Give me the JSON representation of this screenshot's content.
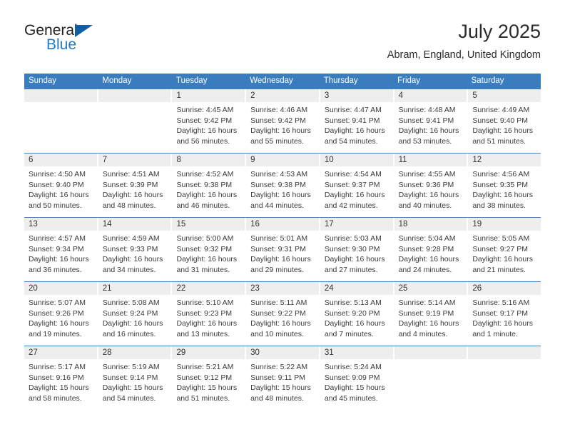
{
  "brand": {
    "name_part1": "General",
    "name_part2": "Blue",
    "accent_color": "#2079c4",
    "triangle_color": "#115da6",
    "triangle_icon": "triangle-icon"
  },
  "header": {
    "title": "July 2025",
    "subtitle": "Abram, England, United Kingdom"
  },
  "theme": {
    "header_bg": "#3a7dbe",
    "header_text": "#ffffff",
    "row_divider": "#4a7ebb",
    "daynum_band_bg": "#eeeeee",
    "cell_bg": "#ffffff",
    "body_text": "#3b3b3b"
  },
  "weekday_headers": [
    "Sunday",
    "Monday",
    "Tuesday",
    "Wednesday",
    "Thursday",
    "Friday",
    "Saturday"
  ],
  "labels": {
    "sunrise_prefix": "Sunrise:",
    "sunset_prefix": "Sunset:",
    "daylight_prefix": "Daylight:"
  },
  "weeks": [
    [
      {
        "day": "",
        "line1": "",
        "line2": "",
        "line3": "",
        "line4": ""
      },
      {
        "day": "",
        "line1": "",
        "line2": "",
        "line3": "",
        "line4": ""
      },
      {
        "day": "1",
        "line1": "Sunrise: 4:45 AM",
        "line2": "Sunset: 9:42 PM",
        "line3": "Daylight: 16 hours",
        "line4": "and 56 minutes."
      },
      {
        "day": "2",
        "line1": "Sunrise: 4:46 AM",
        "line2": "Sunset: 9:42 PM",
        "line3": "Daylight: 16 hours",
        "line4": "and 55 minutes."
      },
      {
        "day": "3",
        "line1": "Sunrise: 4:47 AM",
        "line2": "Sunset: 9:41 PM",
        "line3": "Daylight: 16 hours",
        "line4": "and 54 minutes."
      },
      {
        "day": "4",
        "line1": "Sunrise: 4:48 AM",
        "line2": "Sunset: 9:41 PM",
        "line3": "Daylight: 16 hours",
        "line4": "and 53 minutes."
      },
      {
        "day": "5",
        "line1": "Sunrise: 4:49 AM",
        "line2": "Sunset: 9:40 PM",
        "line3": "Daylight: 16 hours",
        "line4": "and 51 minutes."
      }
    ],
    [
      {
        "day": "6",
        "line1": "Sunrise: 4:50 AM",
        "line2": "Sunset: 9:40 PM",
        "line3": "Daylight: 16 hours",
        "line4": "and 50 minutes."
      },
      {
        "day": "7",
        "line1": "Sunrise: 4:51 AM",
        "line2": "Sunset: 9:39 PM",
        "line3": "Daylight: 16 hours",
        "line4": "and 48 minutes."
      },
      {
        "day": "8",
        "line1": "Sunrise: 4:52 AM",
        "line2": "Sunset: 9:38 PM",
        "line3": "Daylight: 16 hours",
        "line4": "and 46 minutes."
      },
      {
        "day": "9",
        "line1": "Sunrise: 4:53 AM",
        "line2": "Sunset: 9:38 PM",
        "line3": "Daylight: 16 hours",
        "line4": "and 44 minutes."
      },
      {
        "day": "10",
        "line1": "Sunrise: 4:54 AM",
        "line2": "Sunset: 9:37 PM",
        "line3": "Daylight: 16 hours",
        "line4": "and 42 minutes."
      },
      {
        "day": "11",
        "line1": "Sunrise: 4:55 AM",
        "line2": "Sunset: 9:36 PM",
        "line3": "Daylight: 16 hours",
        "line4": "and 40 minutes."
      },
      {
        "day": "12",
        "line1": "Sunrise: 4:56 AM",
        "line2": "Sunset: 9:35 PM",
        "line3": "Daylight: 16 hours",
        "line4": "and 38 minutes."
      }
    ],
    [
      {
        "day": "13",
        "line1": "Sunrise: 4:57 AM",
        "line2": "Sunset: 9:34 PM",
        "line3": "Daylight: 16 hours",
        "line4": "and 36 minutes."
      },
      {
        "day": "14",
        "line1": "Sunrise: 4:59 AM",
        "line2": "Sunset: 9:33 PM",
        "line3": "Daylight: 16 hours",
        "line4": "and 34 minutes."
      },
      {
        "day": "15",
        "line1": "Sunrise: 5:00 AM",
        "line2": "Sunset: 9:32 PM",
        "line3": "Daylight: 16 hours",
        "line4": "and 31 minutes."
      },
      {
        "day": "16",
        "line1": "Sunrise: 5:01 AM",
        "line2": "Sunset: 9:31 PM",
        "line3": "Daylight: 16 hours",
        "line4": "and 29 minutes."
      },
      {
        "day": "17",
        "line1": "Sunrise: 5:03 AM",
        "line2": "Sunset: 9:30 PM",
        "line3": "Daylight: 16 hours",
        "line4": "and 27 minutes."
      },
      {
        "day": "18",
        "line1": "Sunrise: 5:04 AM",
        "line2": "Sunset: 9:28 PM",
        "line3": "Daylight: 16 hours",
        "line4": "and 24 minutes."
      },
      {
        "day": "19",
        "line1": "Sunrise: 5:05 AM",
        "line2": "Sunset: 9:27 PM",
        "line3": "Daylight: 16 hours",
        "line4": "and 21 minutes."
      }
    ],
    [
      {
        "day": "20",
        "line1": "Sunrise: 5:07 AM",
        "line2": "Sunset: 9:26 PM",
        "line3": "Daylight: 16 hours",
        "line4": "and 19 minutes."
      },
      {
        "day": "21",
        "line1": "Sunrise: 5:08 AM",
        "line2": "Sunset: 9:24 PM",
        "line3": "Daylight: 16 hours",
        "line4": "and 16 minutes."
      },
      {
        "day": "22",
        "line1": "Sunrise: 5:10 AM",
        "line2": "Sunset: 9:23 PM",
        "line3": "Daylight: 16 hours",
        "line4": "and 13 minutes."
      },
      {
        "day": "23",
        "line1": "Sunrise: 5:11 AM",
        "line2": "Sunset: 9:22 PM",
        "line3": "Daylight: 16 hours",
        "line4": "and 10 minutes."
      },
      {
        "day": "24",
        "line1": "Sunrise: 5:13 AM",
        "line2": "Sunset: 9:20 PM",
        "line3": "Daylight: 16 hours",
        "line4": "and 7 minutes."
      },
      {
        "day": "25",
        "line1": "Sunrise: 5:14 AM",
        "line2": "Sunset: 9:19 PM",
        "line3": "Daylight: 16 hours",
        "line4": "and 4 minutes."
      },
      {
        "day": "26",
        "line1": "Sunrise: 5:16 AM",
        "line2": "Sunset: 9:17 PM",
        "line3": "Daylight: 16 hours",
        "line4": "and 1 minute."
      }
    ],
    [
      {
        "day": "27",
        "line1": "Sunrise: 5:17 AM",
        "line2": "Sunset: 9:16 PM",
        "line3": "Daylight: 15 hours",
        "line4": "and 58 minutes."
      },
      {
        "day": "28",
        "line1": "Sunrise: 5:19 AM",
        "line2": "Sunset: 9:14 PM",
        "line3": "Daylight: 15 hours",
        "line4": "and 54 minutes."
      },
      {
        "day": "29",
        "line1": "Sunrise: 5:21 AM",
        "line2": "Sunset: 9:12 PM",
        "line3": "Daylight: 15 hours",
        "line4": "and 51 minutes."
      },
      {
        "day": "30",
        "line1": "Sunrise: 5:22 AM",
        "line2": "Sunset: 9:11 PM",
        "line3": "Daylight: 15 hours",
        "line4": "and 48 minutes."
      },
      {
        "day": "31",
        "line1": "Sunrise: 5:24 AM",
        "line2": "Sunset: 9:09 PM",
        "line3": "Daylight: 15 hours",
        "line4": "and 45 minutes."
      },
      {
        "day": "",
        "line1": "",
        "line2": "",
        "line3": "",
        "line4": ""
      },
      {
        "day": "",
        "line1": "",
        "line2": "",
        "line3": "",
        "line4": ""
      }
    ]
  ]
}
